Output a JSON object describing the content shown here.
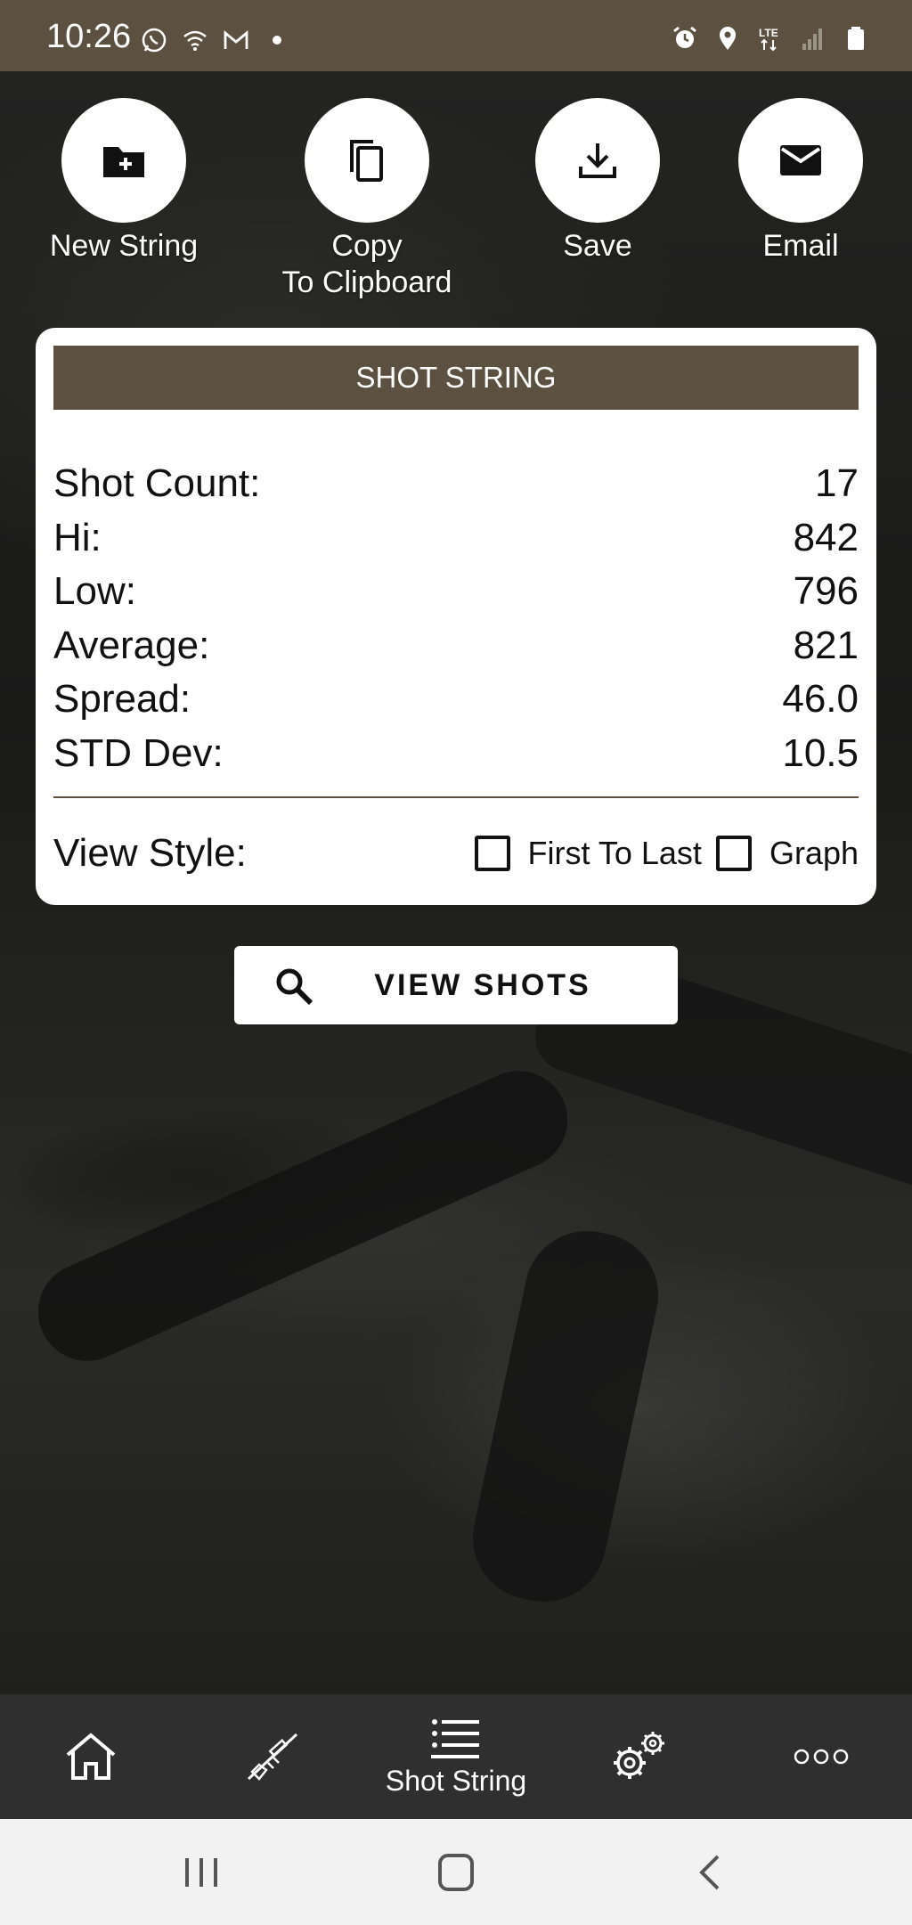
{
  "status_bar": {
    "time": "10:26",
    "left_icons": [
      "whatsapp-icon",
      "wifi-icon",
      "gmail-icon",
      "dot-icon"
    ],
    "right_icons": [
      "alarm-icon",
      "location-icon",
      "lte-icon",
      "signal-icon",
      "battery-icon"
    ],
    "network": "LTE"
  },
  "actions": [
    {
      "label": "New String",
      "icon": "folder-plus-icon"
    },
    {
      "label": "Copy\nTo Clipboard",
      "icon": "copy-icon"
    },
    {
      "label": "Save",
      "icon": "download-icon"
    },
    {
      "label": "Email",
      "icon": "mail-icon"
    }
  ],
  "card": {
    "title": "SHOT STRING",
    "stats": [
      {
        "label": "Shot Count:",
        "value": "17"
      },
      {
        "label": "Hi:",
        "value": "842"
      },
      {
        "label": "Low:",
        "value": "796"
      },
      {
        "label": "Average:",
        "value": "821"
      },
      {
        "label": "Spread:",
        "value": "46.0"
      },
      {
        "label": "STD Dev:",
        "value": "10.5"
      }
    ],
    "view_style_label": "View Style:",
    "options": [
      {
        "label": "First To Last",
        "checked": false
      },
      {
        "label": "Graph",
        "checked": false
      }
    ]
  },
  "view_button": {
    "label": "VIEW SHOTS",
    "icon": "search-icon"
  },
  "bottom_nav": {
    "items": [
      {
        "icon": "home-icon",
        "label": ""
      },
      {
        "icon": "rifle-icon",
        "label": ""
      },
      {
        "icon": "list-icon",
        "label": "Shot String",
        "active": true
      },
      {
        "icon": "gears-icon",
        "label": ""
      },
      {
        "icon": "more-icon",
        "label": ""
      }
    ]
  },
  "colors": {
    "brand": "#5c5140",
    "nav_bg": "#2f2f2f",
    "card_bg": "#ffffff"
  }
}
